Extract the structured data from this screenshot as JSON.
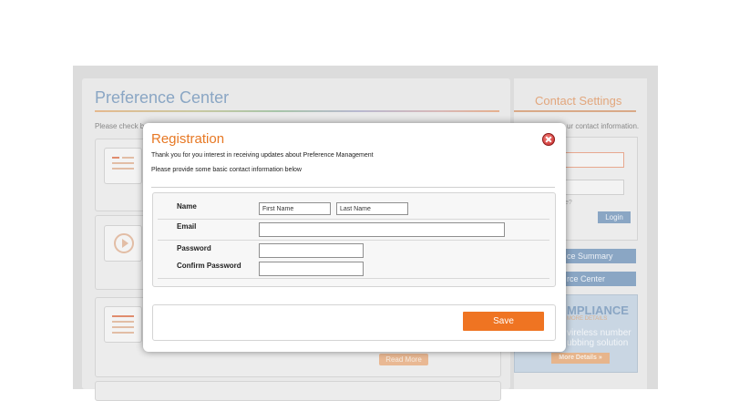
{
  "background": {
    "title": "Preference Center",
    "contact_title": "Contact Settings",
    "intro_left": "Please check ba",
    "intro_right": "ur contact information.",
    "forgot": "e?",
    "login_label": "Login",
    "nav_items": [
      "ce Summary",
      "rce Center"
    ],
    "read_more": "Read More",
    "ad": {
      "title": "MPLIANCE",
      "subtitle": "MORE DETAILS",
      "line1": "vireless number",
      "line2": "ubbing solution",
      "button": "More Details »"
    }
  },
  "modal": {
    "title": "Registration",
    "text1": "Thank you for you interest in receiving updates about Preference Management",
    "text2": "Please provide some basic contact information below",
    "form": {
      "name_label": "Name",
      "first_name_placeholder": "First Name",
      "last_name_placeholder": "Last Name",
      "email_label": "Email",
      "password_label": "Password",
      "confirm_label": "Confirm Password"
    },
    "save_label": "Save"
  },
  "colors": {
    "accent": "#ef7422",
    "title": "#e77824",
    "close": "#c72727"
  }
}
